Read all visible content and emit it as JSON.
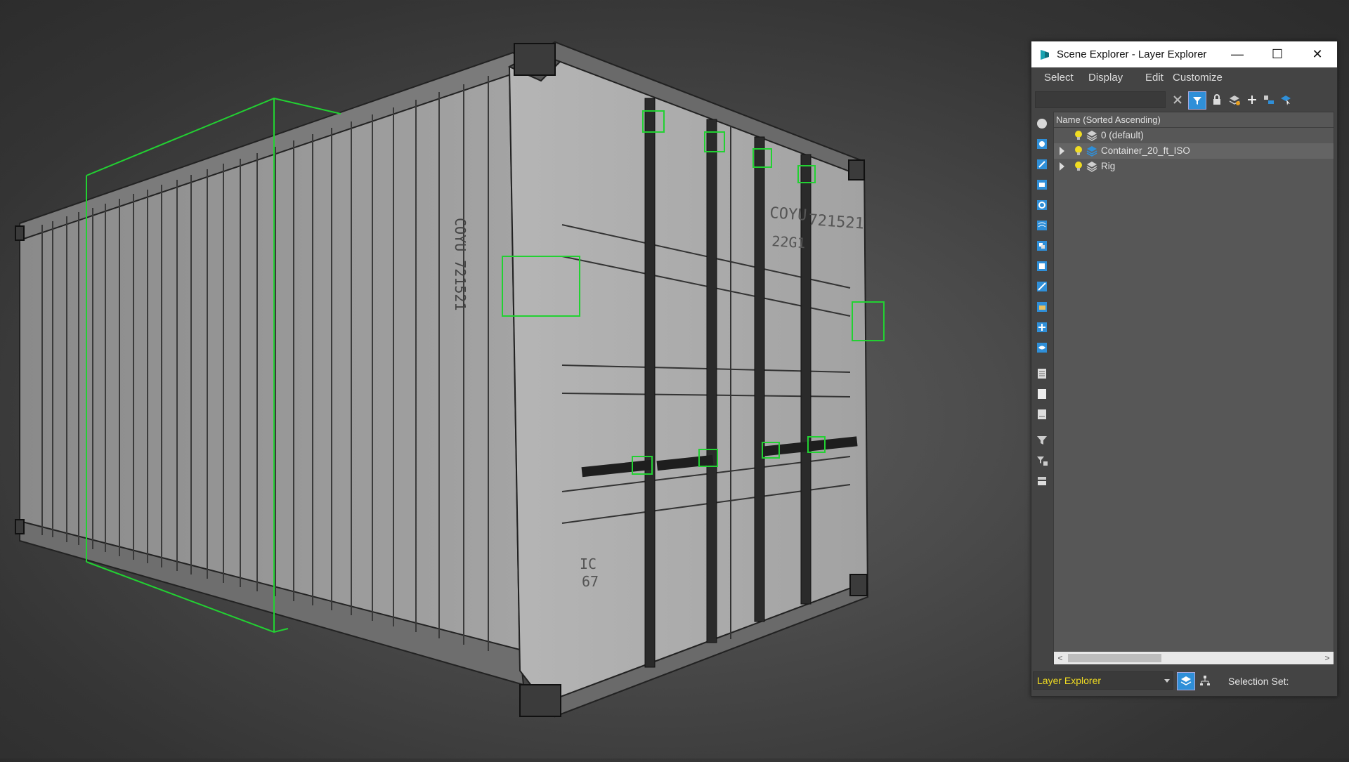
{
  "window": {
    "title": "Scene Explorer - Layer Explorer",
    "minimize_label": "—",
    "maximize_label": "☐",
    "close_label": "✕"
  },
  "menu": {
    "items": [
      "Select",
      "Display",
      "Edit",
      "Customize"
    ]
  },
  "toolbar": {
    "search_value": "",
    "icons": [
      "clear-x-icon",
      "filter-toggle-icon",
      "lock-icon",
      "new-layer-icon",
      "add-icon",
      "move-to-layer-icon",
      "select-icon"
    ]
  },
  "tree": {
    "column_header": "Name (Sorted Ascending)",
    "rows": [
      {
        "label": "0 (default)",
        "expandable": false,
        "active": false
      },
      {
        "label": "Container_20_ft_ISO",
        "expandable": true,
        "active": true
      },
      {
        "label": "Rig",
        "expandable": true,
        "active": false
      }
    ]
  },
  "bottom": {
    "explorer_type": "Layer Explorer",
    "selection_set_label": "Selection Set:"
  },
  "colors": {
    "accent_yellow": "#f0dc22",
    "selection_green": "#22d132",
    "active_layer_blue": "#2f8fd8"
  }
}
